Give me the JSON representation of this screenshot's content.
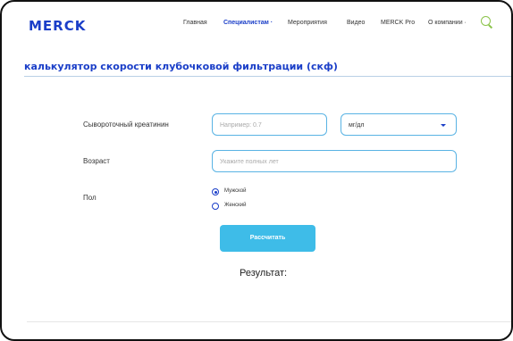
{
  "header": {
    "logo": "Merck",
    "nav": [
      "Главная",
      "Специалистам ·",
      "Мероприятия",
      "Видео",
      "MERCK Pro",
      "О компании ·"
    ],
    "search_icon": "search-icon",
    "brand_color": "#1a3ec8",
    "accent_color": "#8bc34a"
  },
  "page": {
    "title": "калькулятор скорости клубочковой фильтрации (скф)"
  },
  "form": {
    "creatinine_label": "Сывороточный креатинин",
    "creatinine_placeholder": "Например: 0.7",
    "unit_value": "мг/дл",
    "age_label": "Возраст",
    "age_placeholder": "Укажите полных лет",
    "sex_label": "Пол",
    "sex_options": [
      "Мужской",
      "Женский"
    ],
    "sex_selected": "Мужской",
    "calculate_label": "Рассчитать",
    "button_color": "#3ebce8"
  },
  "result": {
    "label": "Результат:"
  }
}
